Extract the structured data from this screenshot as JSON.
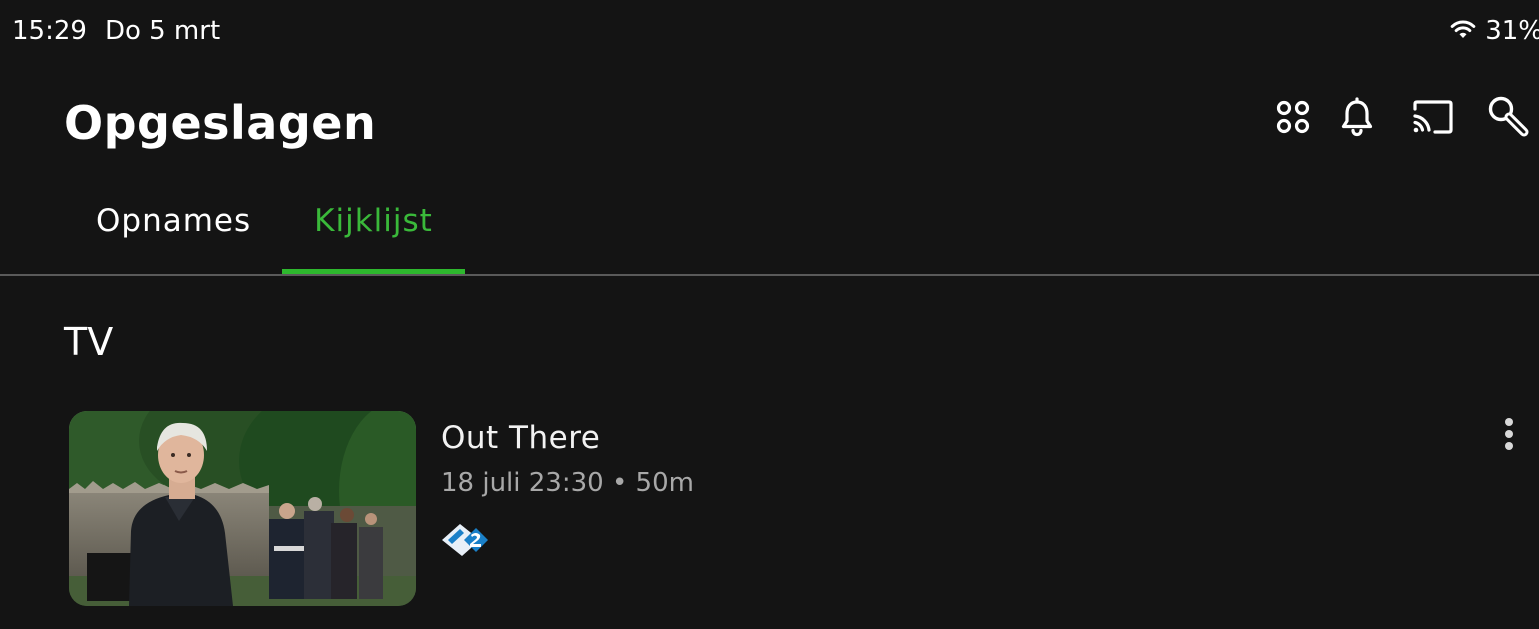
{
  "status_bar": {
    "time": "15:29",
    "date": "Do 5 mrt",
    "battery": "31%",
    "icons": [
      "wifi-icon"
    ]
  },
  "header": {
    "title": "Opgeslagen",
    "icons": [
      "apps-grid-icon",
      "bell-icon",
      "cast-icon",
      "search-icon"
    ]
  },
  "tabs": [
    {
      "label": "Opnames",
      "active": false
    },
    {
      "label": "Kijklijst",
      "active": true
    }
  ],
  "colors": {
    "background": "#141414",
    "accent": "#2eb82e",
    "text_secondary": "#a8a8a8",
    "divider": "#5a5a5a"
  },
  "section": {
    "title": "TV",
    "items": [
      {
        "title": "Out There",
        "meta": "18 juli 23:30 • 50m",
        "channel_icon": "npo2-logo-icon",
        "more_icon": "more-vertical-icon"
      }
    ]
  }
}
